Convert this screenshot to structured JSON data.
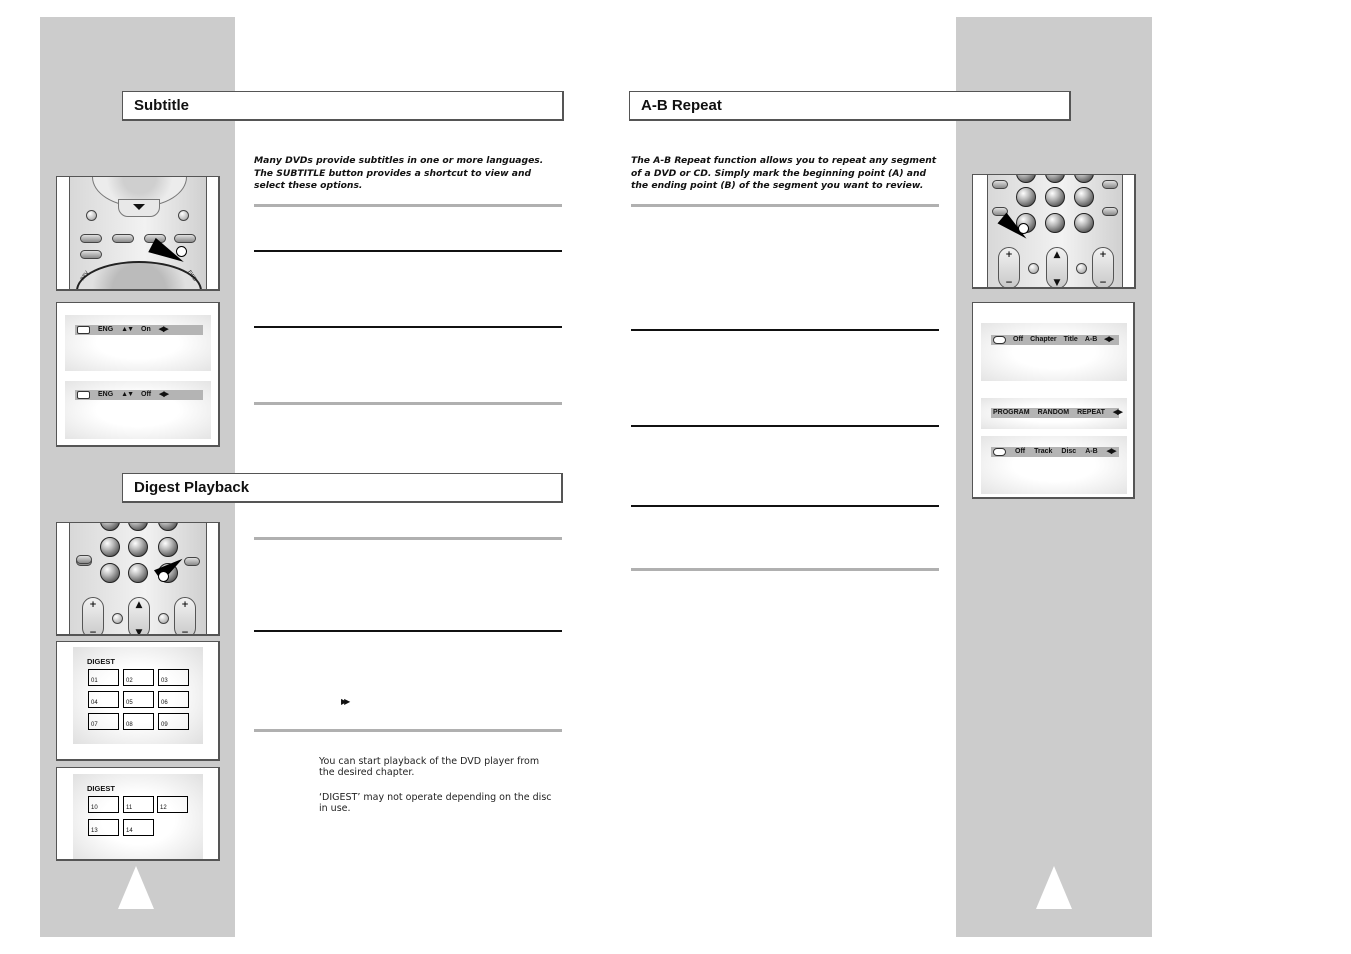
{
  "sections": {
    "subtitle": {
      "title": "Subtitle",
      "intro": "Many DVDs provide subtitles in one or more languages. The SUBTITLE button provides a shortcut to view and select these options.",
      "osd_screens": [
        {
          "lang": "ENG",
          "updown": "▲▼",
          "value": "On",
          "leftright": "◀▶"
        },
        {
          "lang": "ENG",
          "updown": "▲▼",
          "value": "Off",
          "leftright": "◀▶"
        }
      ]
    },
    "digest": {
      "title": "Digest Playback",
      "ff_symbol": "▶▶",
      "notes": [
        "You can start playback of the DVD player from the desired chapter.",
        "‘DIGEST’ may not operate depending on the disc in use."
      ],
      "screen1": {
        "title": "DIGEST",
        "cells": [
          "01",
          "02",
          "03",
          "04",
          "05",
          "06",
          "07",
          "08",
          "09"
        ]
      },
      "screen2": {
        "title": "DIGEST",
        "cells": [
          "10",
          "11",
          "12",
          "13",
          "14"
        ]
      }
    },
    "ab_repeat": {
      "title": "A-B Repeat",
      "intro": "The A-B Repeat function allows you to repeat any segment of a DVD or CD. Simply mark the beginning point (A) and the ending point (B) of the segment you want to review.",
      "osd_dvd": {
        "options": [
          "Off",
          "Chapter",
          "Title",
          "A-B"
        ],
        "leftright": "◀▶"
      },
      "osd_cd_menu": {
        "options": [
          "PROGRAM",
          "RANDOM",
          "REPEAT"
        ],
        "leftright": "◀▶"
      },
      "osd_cd": {
        "options": [
          "Off",
          "Track",
          "Disc",
          "A-B"
        ],
        "leftright": "◀▶"
      }
    }
  },
  "remote_labels": {
    "rev": "REV",
    "fwd": "FWD",
    "plus": "+",
    "minus": "−",
    "up": "▲",
    "down": "▼"
  },
  "colors": {
    "sidebar": "#cccccc",
    "rule_gray": "#b0b0b0",
    "rule_black": "#111111",
    "osd_bar": "#b4b4b4"
  }
}
